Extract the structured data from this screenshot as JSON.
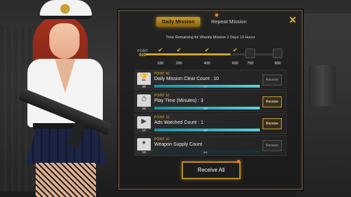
{
  "tabs": [
    {
      "label": "Daily Mission",
      "active": true
    },
    {
      "label": "Repeat Mission",
      "active": false
    }
  ],
  "time_remaining": "Time Remaining for Weekly Mission  2 Days 13 Hours",
  "progress": {
    "point_label": "POINT",
    "point_value": "600",
    "milestones": [
      "100",
      "200",
      "400",
      "600",
      "700",
      "900"
    ],
    "completed": [
      true,
      true,
      true,
      true,
      false,
      false
    ],
    "fill_fraction": 0.62
  },
  "missions": [
    {
      "point": "POINT 50",
      "title": "Daily Mission Clear Count : 10",
      "progress": "10",
      "fill": 1.0,
      "reward": "50",
      "button": "Receive",
      "ready": false,
      "icon": "trophy-icon"
    },
    {
      "point": "POINT 10",
      "title": "Play Time (Minutes) : 3",
      "progress": "3/3",
      "fill": 1.0,
      "reward": "20",
      "button": "Receive",
      "ready": true,
      "icon": "clock-icon"
    },
    {
      "point": "POINT 10",
      "title": "Ads Watched Count : 1",
      "progress": "1/1",
      "fill": 1.0,
      "reward": "10",
      "button": "Receive",
      "ready": true,
      "icon": "video-icon"
    },
    {
      "point": "POINT 10",
      "title": "Weapon Supply Count",
      "progress": "0/1",
      "fill": 0.0,
      "reward": "10",
      "button": "Receive",
      "ready": false,
      "icon": "supply-icon"
    }
  ],
  "receive_all": "Receive All",
  "colors": {
    "accent": "#d2a22e",
    "bar": "#3fb7c7"
  }
}
